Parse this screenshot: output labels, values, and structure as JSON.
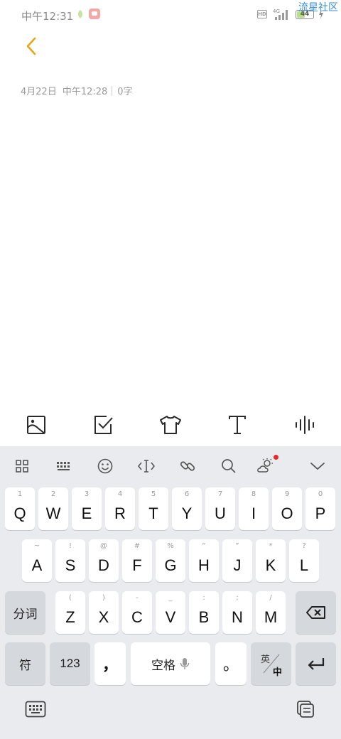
{
  "status_bar": {
    "time": "中午12:31",
    "network": "4G",
    "battery": "44",
    "battery_level": 0.44,
    "watermark": "流星社区"
  },
  "note": {
    "date": "4月22日",
    "time": "中午12:28",
    "word_count": "0字"
  },
  "note_toolbar": {
    "icons": [
      "image-icon",
      "checklist-icon",
      "shirt-icon",
      "text-format-icon",
      "voice-icon"
    ]
  },
  "keyboard_toolbar": {
    "icons": [
      "grid-menu-icon",
      "keyboard-layout-icon",
      "emoji-icon",
      "cursor-icon",
      "link-icon",
      "search-icon",
      "weather-icon",
      "collapse-icon"
    ],
    "notification_dot_color": "#e8262b"
  },
  "keyboard": {
    "row1": [
      {
        "key": "Q",
        "hint": "1"
      },
      {
        "key": "W",
        "hint": "2"
      },
      {
        "key": "E",
        "hint": "3"
      },
      {
        "key": "R",
        "hint": "4"
      },
      {
        "key": "T",
        "hint": "5"
      },
      {
        "key": "Y",
        "hint": "6"
      },
      {
        "key": "U",
        "hint": "7"
      },
      {
        "key": "I",
        "hint": "8"
      },
      {
        "key": "O",
        "hint": "9"
      },
      {
        "key": "P",
        "hint": "0"
      }
    ],
    "row2": [
      {
        "key": "A",
        "hint": "~"
      },
      {
        "key": "S",
        "hint": "!"
      },
      {
        "key": "D",
        "hint": "@"
      },
      {
        "key": "F",
        "hint": "#"
      },
      {
        "key": "G",
        "hint": "%"
      },
      {
        "key": "H",
        "hint": "“"
      },
      {
        "key": "J",
        "hint": "”"
      },
      {
        "key": "K",
        "hint": "*"
      },
      {
        "key": "L",
        "hint": "?"
      }
    ],
    "row3": [
      {
        "key": "Z",
        "hint": "("
      },
      {
        "key": "X",
        "hint": ")"
      },
      {
        "key": "C",
        "hint": "-"
      },
      {
        "key": "V",
        "hint": "_"
      },
      {
        "key": "B",
        "hint": ":"
      },
      {
        "key": "N",
        "hint": ";"
      },
      {
        "key": "M",
        "hint": "/"
      }
    ],
    "segment_key": "分词",
    "symbol_key": "符",
    "number_key": "123",
    "comma_key": "，",
    "space_key": "空格",
    "period_key": "。",
    "lang_key_top": "英",
    "lang_key_bottom": "中"
  },
  "accent_color": "#e6a817"
}
